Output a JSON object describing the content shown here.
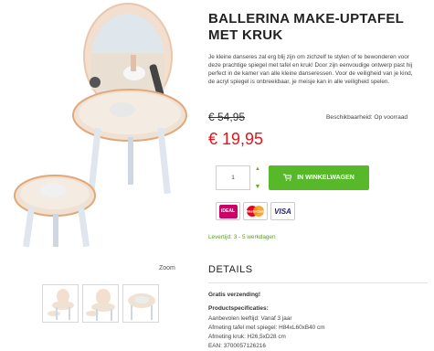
{
  "product": {
    "title": "BALLERINA MAKE-UPTAFEL MET KRUK",
    "description": "Je kleine danseres zal erg blij zijn om zichzelf te stylen of te bewonderen voor deze prachtige spiegel met tafel en kruk! Door zijn eenvoudige ontwerp past hij perfect in de kamer van alle kleine danseressen. Voor de veiligheid van je kind, de acryl spiegel is onbreekbaar, je meisje kan in alle veiligheid spelen.",
    "old_price": "€ 54,95",
    "price": "€ 19,95",
    "availability": "Beschikbaarheid: Op voorraad"
  },
  "gallery": {
    "zoom_label": "Zoom"
  },
  "cart": {
    "quantity": "1",
    "qty_up": "^",
    "qty_down": "v",
    "button_label": "IN WINKELWAGEN"
  },
  "payments": {
    "ideal_label": "iDEAL",
    "mastercard_label": "MasterCard",
    "visa_label": "VISA"
  },
  "delivery": "Levertijd: 3 - 5 werkdagen",
  "details": {
    "heading": "DETAILS",
    "shipping": "Gratis verzending!",
    "specs_heading": "Productspecificaties:",
    "specs": [
      "Aanbevolen leeftijd: Vanaf 3 jaar",
      "Afmeting tafel met spiegel: H84xL60xB40 cm",
      "Afmeting kruk: H26,5xD28 cm",
      "EAN: 3700057126216"
    ]
  },
  "colors": {
    "green": "#57b82a",
    "price_red": "#e0161f",
    "table_wood": "#f0e2d3"
  }
}
